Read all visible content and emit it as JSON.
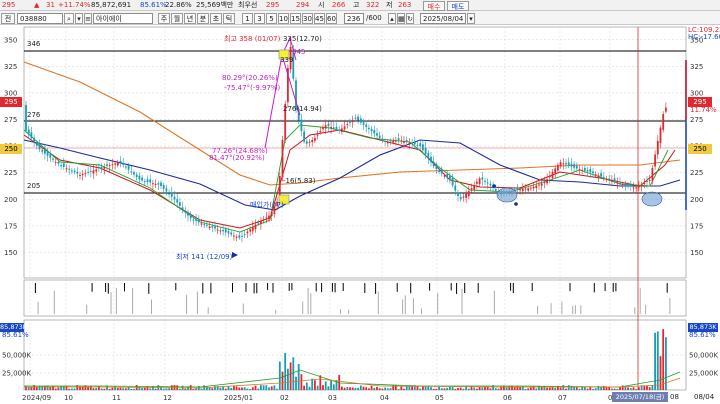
{
  "toolbar": {
    "price_tag": "295",
    "change_arrow": "▲",
    "change_value": "31",
    "change_pct": "+11.74%",
    "volume": "85,872,691",
    "ratio": "85.61%",
    "ratio2": "22.86%",
    "amount": "25,569백만",
    "stock_name_short": "최우선",
    "ask": "295",
    "bid": "294",
    "open_label": "시",
    "open": "266",
    "high_label": "고",
    "high": "322",
    "low_label": "저",
    "low": "263",
    "buy_button": "매수",
    "sell_button": "매도"
  },
  "controls": {
    "mode": "전",
    "code": "038880",
    "name": "아이에이",
    "periods": [
      "주",
      "월",
      "년",
      "분",
      "초",
      "틱"
    ],
    "intervals": [
      "1",
      "3",
      "5",
      "10",
      "15",
      "30",
      "45",
      "60"
    ],
    "count": "236",
    "total": "/600",
    "date": "2025/08/04"
  },
  "price_chart": {
    "y_ticks": [
      "350",
      "325",
      "300",
      "275",
      "250",
      "225",
      "200",
      "175",
      "150"
    ],
    "right_badges": {
      "current": "295",
      "current_pct": "11.74%",
      "mid": "250",
      "lc": "LC:109.22",
      "hc": "HC:-17.60"
    },
    "level_labels": {
      "top": "346",
      "mid": "276",
      "low": "205"
    },
    "annotations": {
      "high": "최고 358 (01/07)",
      "high_pct": "335(12.70)",
      "a1": "80.29°(20.26%)",
      "a2": "-75.47°(-9.97%)",
      "a3": "77.26°(24.68%)",
      "a4": "81.47°(20.92%)",
      "a5": "276(14.94)",
      "a6": "-16(5.83)",
      "a7": "매입가(07)",
      "low": "최저 141 (12/09)",
      "val339": "339",
      "val345": "345"
    }
  },
  "volume_chart": {
    "badge_top": "85,873K",
    "badge_pct": "85.61%",
    "y_ticks": [
      "50,000K",
      "25,000K"
    ]
  },
  "x_axis": {
    "labels": [
      "2024/09",
      "10",
      "11",
      "12",
      "2025/01",
      "02",
      "03",
      "04",
      "05",
      "06",
      "07",
      "08"
    ],
    "cursor_label": "2025/07/18(금)",
    "cursor_right": "08",
    "last": "08/04"
  },
  "colors": {
    "up": "#e0282e",
    "down": "#1a9bb5",
    "ma_orange": "#d9772a",
    "ma_navy": "#1b2a9c",
    "ma_red": "#c8151b",
    "ma_green": "#21a121",
    "grid": "#d4d4d4"
  }
}
